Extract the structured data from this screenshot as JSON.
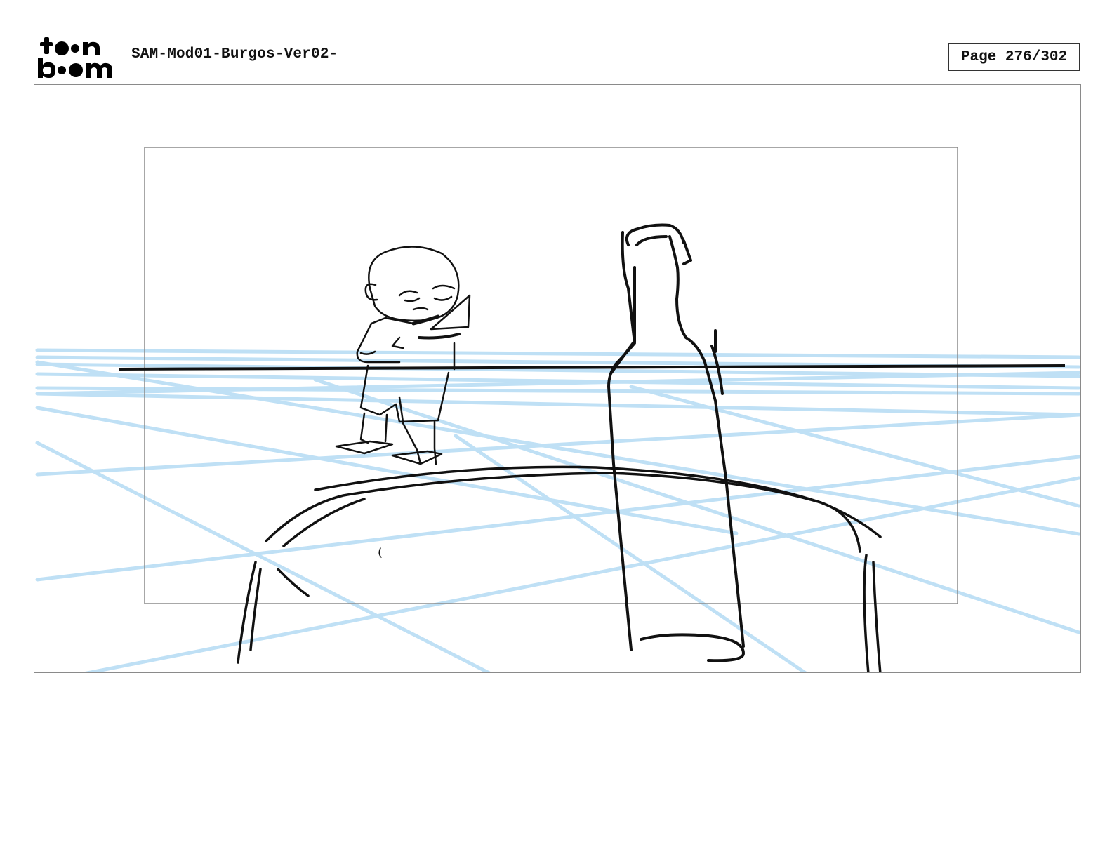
{
  "header": {
    "logo_text": "toon boom",
    "document_title": "SAM-Mod01-Burgos-Ver02-",
    "page_label": "Page 276/302"
  },
  "colors": {
    "ink": "#111111",
    "perspective_grid": "#bfe0f5",
    "frame_border": "#8a8a8a"
  },
  "panel": {
    "description_visible": false
  }
}
